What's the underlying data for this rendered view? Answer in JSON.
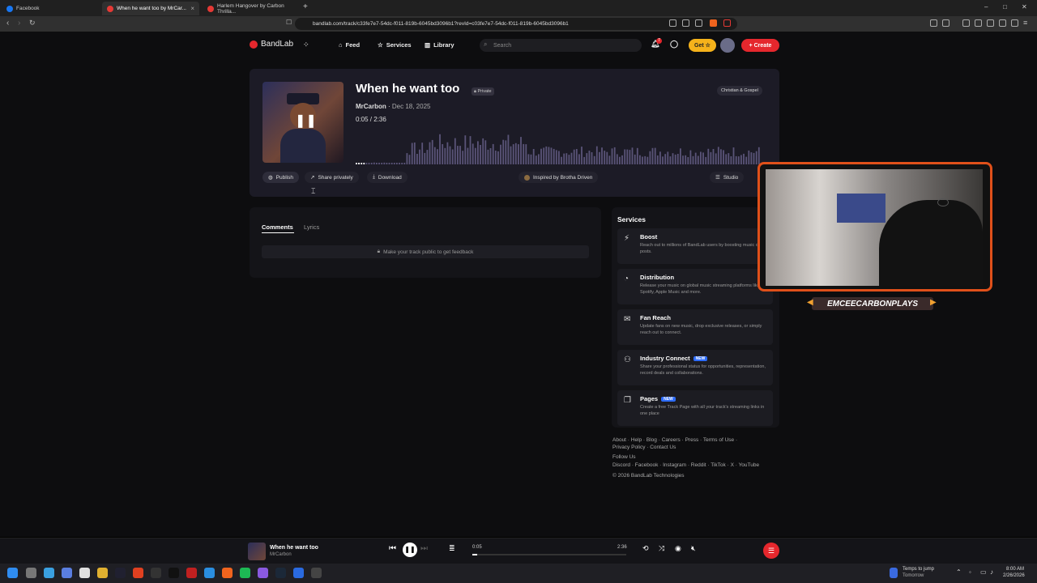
{
  "browser": {
    "tabs": [
      {
        "title": "Facebook",
        "color": "#1877f2"
      },
      {
        "title": "When he want too by MrCar...",
        "color": "#e53935"
      },
      {
        "title": "Harlem Hangover by Carbon Thrilla...",
        "color": "#e53935"
      }
    ],
    "url": "bandlab.com/track/c33fe7e7-54dc-f011-819b-6045bd3096b1?revId=c03fe7e7-54dc-f011-819b-6045bd3096b1"
  },
  "topnav": {
    "brand": "BandLab",
    "links": [
      "Feed",
      "Services",
      "Library"
    ],
    "search_placeholder": "Search",
    "notification_count": "7",
    "get_label": "Get",
    "create_label": "Create"
  },
  "track": {
    "title": "When he want too",
    "privacy": "Private",
    "artist": "MrCarbon",
    "date": "Dec 18, 2025",
    "current_time": "0:05",
    "duration": "2:36",
    "genre": "Christian & Gospel",
    "buttons": {
      "publish": "Publish",
      "share": "Share privately",
      "download": "Download",
      "inspired": "Inspired by Brotha Driven",
      "studio": "Studio"
    }
  },
  "comments": {
    "tabs": [
      "Comments",
      "Lyrics"
    ],
    "notice": "Make your track public to get feedback"
  },
  "services": {
    "heading": "Services",
    "items": [
      {
        "title": "Boost",
        "desc": "Reach out to millions of BandLab users by boosting music or posts.",
        "is_new": false,
        "new_label": ""
      },
      {
        "title": "Distribution",
        "desc": "Release your music on global music streaming platforms like Spotify, Apple Music and more.",
        "is_new": false,
        "new_label": ""
      },
      {
        "title": "Fan Reach",
        "desc": "Update fans on new music, drop exclusive releases, or simply reach out to connect.",
        "is_new": false,
        "new_label": ""
      },
      {
        "title": "Industry Connect",
        "desc": "Share your professional status for opportunities, representation, record deals and collaborations.",
        "is_new": true,
        "new_label": "NEW"
      },
      {
        "title": "Pages",
        "desc": "Create a free Track Page with all your track's streaming links in one place",
        "is_new": true,
        "new_label": "NEW"
      }
    ]
  },
  "footer": {
    "line1": "About · Help · Blog · Careers · Press · Terms of Use ·",
    "line2": "Privacy Policy · Contact Us",
    "follow": "Follow Us",
    "social": "Discord · Facebook · Instagram · Reddit · TikTok · X · YouTube",
    "copyright": "© 2026 BandLab Technologies"
  },
  "webcam": {
    "label": "EMCEECARBONPLAYS"
  },
  "player": {
    "title": "When he want too",
    "artist": "MrCarbon",
    "current_time": "0:05",
    "duration": "2:36",
    "progress": 0.032
  },
  "taskbar": {
    "weather_line1": "Temps to jump",
    "weather_line2": "Tomorrow",
    "time": "8:00 AM",
    "date": "2/26/2026"
  },
  "colors": {
    "accent": "#e5272d",
    "get": "#f5b21b",
    "waveform": "#5a5478"
  }
}
